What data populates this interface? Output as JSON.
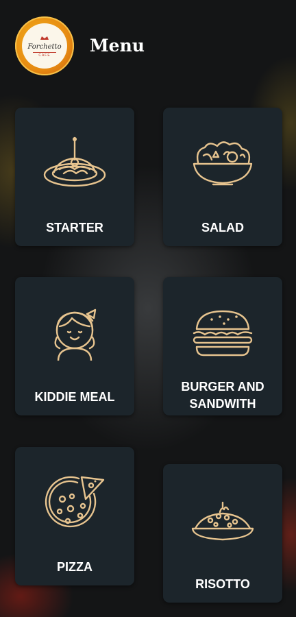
{
  "header": {
    "title": "Menu",
    "logo": {
      "name": "Forchetto",
      "sub": "CAFE"
    }
  },
  "categories": [
    {
      "label": "STARTER",
      "icon": "starter-plate-icon"
    },
    {
      "label": "SALAD",
      "icon": "salad-bowl-icon"
    },
    {
      "label": "KIDDIE MEAL",
      "icon": "kid-girl-icon"
    },
    {
      "label": "BURGER AND SANDWITH",
      "icon": "burger-icon"
    },
    {
      "label": "PIZZA",
      "icon": "pizza-icon"
    },
    {
      "label": "RISOTTO",
      "icon": "risotto-icon"
    }
  ],
  "colors": {
    "icon": "#e7c48f",
    "card": "#1c252b",
    "logo": "#e68a12"
  }
}
